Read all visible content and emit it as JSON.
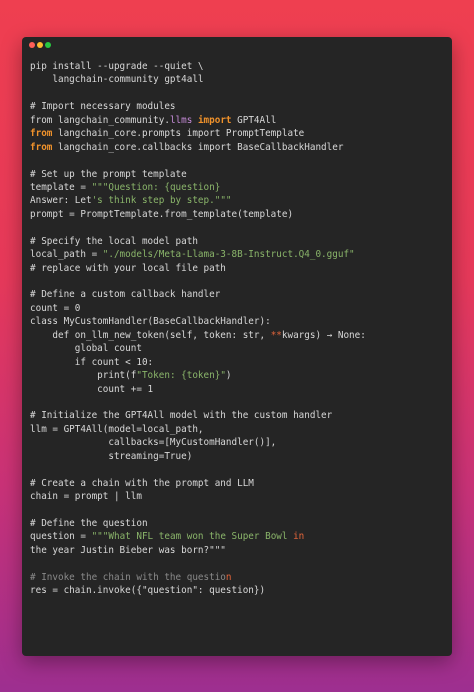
{
  "window": {
    "title_dots": [
      "close",
      "minimize",
      "maximize"
    ],
    "colors": {
      "background": "#252525",
      "keyword": "#f0922b",
      "string": "#8ab56a",
      "module": "#c58bd8",
      "text": "#d8d8d8",
      "muted": "#8a8a8a"
    }
  },
  "code": {
    "lines": [
      [
        {
          "t": "pip install --upgrade --quiet \\",
          "c": ""
        }
      ],
      [
        {
          "t": "    langchain-community gpt4all",
          "c": ""
        }
      ],
      [],
      [
        {
          "t": "# Import necessary modules",
          "c": "tok-cm"
        }
      ],
      [
        {
          "t": "from langchain_community.",
          "c": ""
        },
        {
          "t": "llms",
          "c": "tok-mod"
        },
        {
          "t": " ",
          "c": ""
        },
        {
          "t": "import",
          "c": "tok-kw"
        },
        {
          "t": " GPT4All",
          "c": ""
        }
      ],
      [
        {
          "t": "from",
          "c": "tok-kw"
        },
        {
          "t": " langchain_core.prompts import PromptTemplate",
          "c": ""
        }
      ],
      [
        {
          "t": "from",
          "c": "tok-kw"
        },
        {
          "t": " langchain_core.callbacks import BaseCallbackHandler",
          "c": ""
        }
      ],
      [],
      [
        {
          "t": "# Set up the prompt template",
          "c": "tok-cm"
        }
      ],
      [
        {
          "t": "template = ",
          "c": ""
        },
        {
          "t": "\"\"\"Question: {question}",
          "c": "tok-str"
        }
      ],
      [
        {
          "t": "Answer: Let",
          "c": ""
        },
        {
          "t": "'s think step by step.\"\"\"",
          "c": "tok-str"
        }
      ],
      [
        {
          "t": "prompt = PromptTemplate.from_template(template)",
          "c": ""
        }
      ],
      [],
      [
        {
          "t": "# Specify the local model path",
          "c": "tok-cm"
        }
      ],
      [
        {
          "t": "local_path = ",
          "c": ""
        },
        {
          "t": "\"./models/Meta-Llama-3-8B-Instruct.Q4_0.gguf\"",
          "c": "tok-str"
        }
      ],
      [
        {
          "t": "# replace with your local file path",
          "c": "tok-cm"
        }
      ],
      [],
      [
        {
          "t": "# Define a custom callback handler",
          "c": "tok-cm"
        }
      ],
      [
        {
          "t": "count = 0",
          "c": ""
        }
      ],
      [
        {
          "t": "class MyCustomHandler(BaseCallbackHandler):",
          "c": ""
        }
      ],
      [
        {
          "t": "    def on_llm_new_token(self, token: str, ",
          "c": ""
        },
        {
          "t": "**",
          "c": "tok-red"
        },
        {
          "t": "kwargs) → None:",
          "c": ""
        }
      ],
      [
        {
          "t": "        global count",
          "c": ""
        }
      ],
      [
        {
          "t": "        if count < 10:",
          "c": ""
        }
      ],
      [
        {
          "t": "            print(f",
          "c": ""
        },
        {
          "t": "\"Token: {token}\"",
          "c": "tok-str"
        },
        {
          "t": ")",
          "c": ""
        }
      ],
      [
        {
          "t": "            count += 1",
          "c": ""
        }
      ],
      [],
      [
        {
          "t": "# Initialize the GPT4All model with the custom handler",
          "c": "tok-cm"
        }
      ],
      [
        {
          "t": "llm = GPT4All(model=local_path,",
          "c": ""
        }
      ],
      [
        {
          "t": "              callbacks=[MyCustomHandler()],",
          "c": ""
        }
      ],
      [
        {
          "t": "              streaming=True)",
          "c": ""
        }
      ],
      [],
      [
        {
          "t": "# Create a chain with the prompt and LLM",
          "c": "tok-cm"
        }
      ],
      [
        {
          "t": "chain = prompt | llm",
          "c": ""
        }
      ],
      [],
      [
        {
          "t": "# Define the question",
          "c": "tok-cm"
        }
      ],
      [
        {
          "t": "question = ",
          "c": ""
        },
        {
          "t": "\"\"\"What NFL team won the Super Bowl ",
          "c": "tok-str"
        },
        {
          "t": "in",
          "c": "tok-red"
        }
      ],
      [
        {
          "t": "the year Justin Bieber was born?\"\"\"",
          "c": ""
        }
      ],
      [],
      [
        {
          "t": "# Invoke the chain with the questio",
          "c": "tok-cm2"
        },
        {
          "t": "n",
          "c": "tok-red"
        }
      ],
      [
        {
          "t": "res = chain.invoke({\"question\": question})",
          "c": ""
        }
      ]
    ]
  }
}
